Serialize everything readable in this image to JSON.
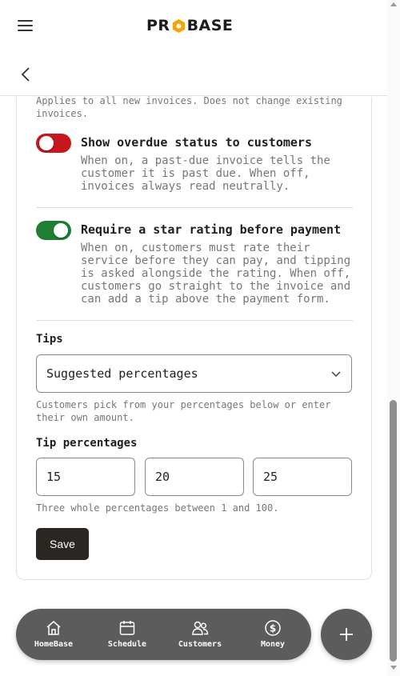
{
  "header": {
    "logo_left": "PR",
    "logo_right": "BASE"
  },
  "settings": {
    "top_note": "Applies to all new invoices. Does not change existing invoices.",
    "toggles": [
      {
        "title": "Show overdue status to customers",
        "description": "When on, a past-due invoice tells the customer it is past due. When off, invoices always read neutrally.",
        "state": "off",
        "color": "#c8161e"
      },
      {
        "title": "Require a star rating before payment",
        "description": "When on, customers must rate their service before they can pay, and tipping is asked alongside the rating. When off, customers go straight to the invoice and can add a tip above the payment form.",
        "state": "on",
        "color": "#1e7e34"
      }
    ],
    "tips": {
      "label": "Tips",
      "selected": "Suggested percentages",
      "help": "Customers pick from your percentages below or enter their own amount."
    },
    "tip_percentages": {
      "label": "Tip percentages",
      "values": [
        "15",
        "20",
        "25"
      ],
      "help": "Three whole percentages between 1 and 100."
    },
    "save_label": "Save"
  },
  "nav": {
    "items": [
      {
        "label": "HomeBase",
        "icon": "home-icon"
      },
      {
        "label": "Schedule",
        "icon": "calendar-icon"
      },
      {
        "label": "Customers",
        "icon": "users-icon"
      },
      {
        "label": "Money",
        "icon": "dollar-icon"
      }
    ],
    "fab_icon": "plus-icon"
  },
  "colors": {
    "accent_dark": "#2a2622",
    "nav_bg": "#5c5c5c",
    "logo_hex": "#f5a400"
  }
}
